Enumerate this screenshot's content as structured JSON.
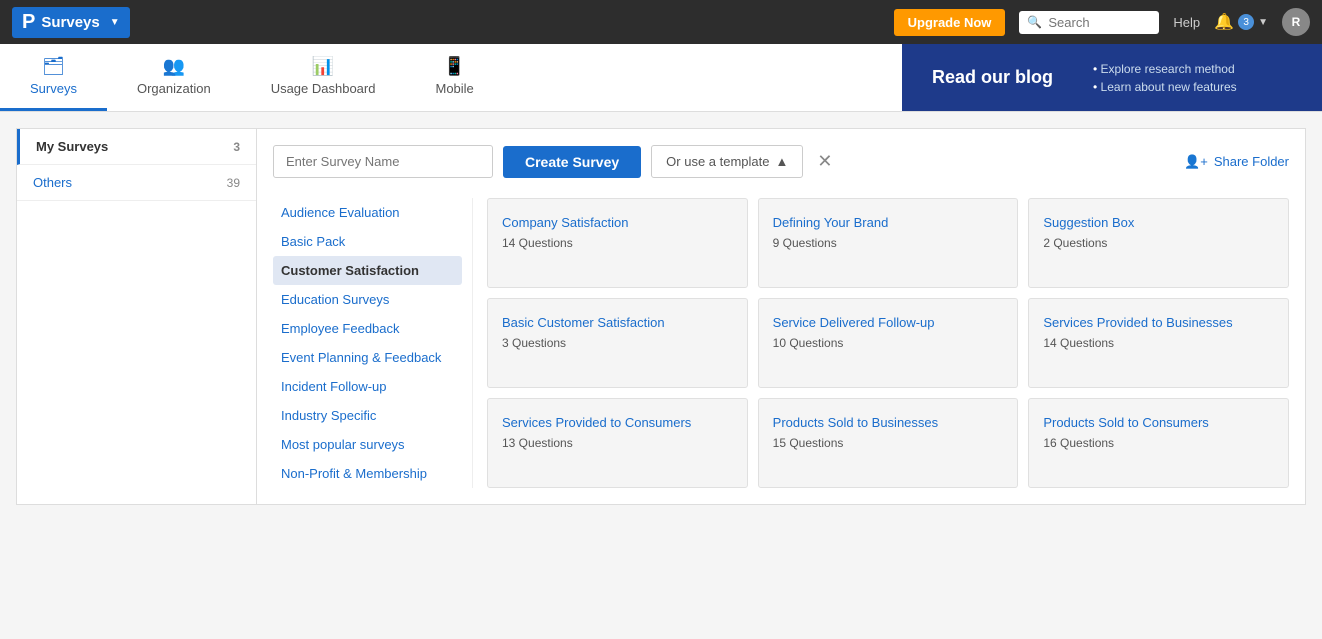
{
  "topNav": {
    "brand": "Surveys",
    "logoLetter": "P",
    "upgradeLabel": "Upgrade Now",
    "searchPlaceholder": "Search",
    "helpLabel": "Help",
    "notifCount": "3",
    "userInitial": "R"
  },
  "secondaryNav": {
    "tabs": [
      {
        "label": "Surveys",
        "icon": "🗂",
        "active": true
      },
      {
        "label": "Organization",
        "icon": "👥",
        "active": false
      },
      {
        "label": "Usage Dashboard",
        "icon": "📊",
        "active": false
      },
      {
        "label": "Mobile",
        "icon": "📱",
        "active": false
      }
    ],
    "blog": {
      "title": "Read our blog",
      "bullets": [
        "Explore research method",
        "Learn about new features"
      ]
    }
  },
  "sidebar": {
    "mySurveysLabel": "My Surveys",
    "mySurveysCount": "3",
    "othersLabel": "Others",
    "othersCount": "39"
  },
  "toolbar": {
    "surveyNamePlaceholder": "Enter Survey Name",
    "createSurveyLabel": "Create Survey",
    "templateLabel": "Or use a template",
    "shareFolderLabel": "Share Folder"
  },
  "categories": [
    {
      "label": "Audience Evaluation",
      "active": false
    },
    {
      "label": "Basic Pack",
      "active": false
    },
    {
      "label": "Customer Satisfaction",
      "active": true
    },
    {
      "label": "Education Surveys",
      "active": false
    },
    {
      "label": "Employee Feedback",
      "active": false
    },
    {
      "label": "Event Planning & Feedback",
      "active": false
    },
    {
      "label": "Incident Follow-up",
      "active": false
    },
    {
      "label": "Industry Specific",
      "active": false
    },
    {
      "label": "Most popular surveys",
      "active": false
    },
    {
      "label": "Non-Profit & Membership",
      "active": false
    }
  ],
  "templates": [
    {
      "title": "Company Satisfaction",
      "count": "14 Questions"
    },
    {
      "title": "Defining Your Brand",
      "count": "9 Questions"
    },
    {
      "title": "Suggestion Box",
      "count": "2 Questions"
    },
    {
      "title": "Basic Customer Satisfaction",
      "count": "3 Questions"
    },
    {
      "title": "Service Delivered Follow-up",
      "count": "10 Questions"
    },
    {
      "title": "Services Provided to Businesses",
      "count": "14 Questions"
    },
    {
      "title": "Services Provided to Consumers",
      "count": "13 Questions"
    },
    {
      "title": "Products Sold to Businesses",
      "count": "15 Questions"
    },
    {
      "title": "Products Sold to Consumers",
      "count": "16 Questions"
    }
  ]
}
